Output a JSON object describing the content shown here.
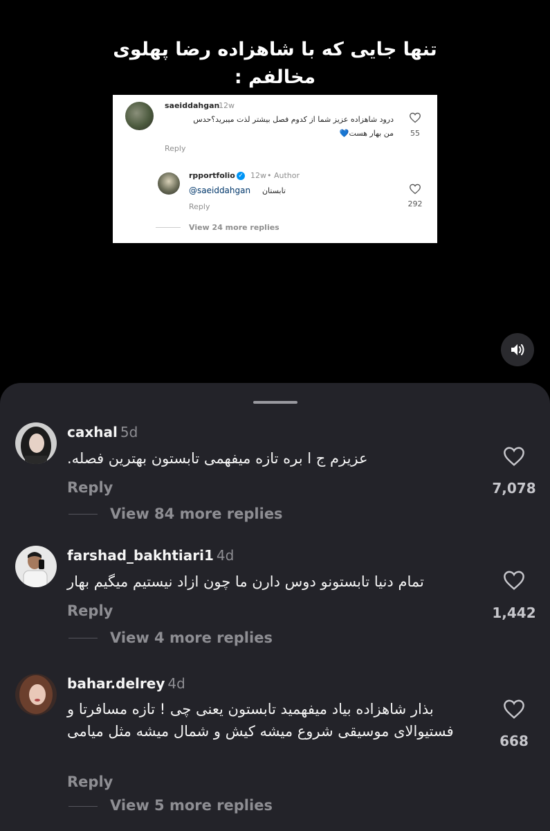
{
  "overlay": {
    "line1": "تنها جایی که با شاهزاده رضا پهلوی",
    "line2": "مخالفم :"
  },
  "embed": {
    "comment": {
      "username": "saeiddahgan",
      "time": "12w",
      "text_line1": "درود شاهزاده عزیز شما از کدوم فصل بیشتر لذت میبرید؟حدس",
      "text_line2": "من بهار هست💙",
      "reply_label": "Reply",
      "likes": "55"
    },
    "reply": {
      "username": "rpportfolio",
      "time": "12w",
      "author_label": "• Author",
      "mention": "@saeiddahgan",
      "text": "تابستان",
      "reply_label": "Reply",
      "likes": "292"
    },
    "view_more": "View 24 more replies"
  },
  "comments": [
    {
      "username": "caxhal",
      "time": "5d",
      "text": "عزیزم ج ا بره تازه میفهمی تابستون بهترین فصله.",
      "reply_label": "Reply",
      "likes": "7,078",
      "view_more": "View 84 more replies"
    },
    {
      "username": "farshad_bakhtiari1",
      "time": "4d",
      "text": "تمام دنیا تابستونو دوس دارن ما چون ازاد نیستیم میگیم بهار",
      "reply_label": "Reply",
      "likes": "1,442",
      "view_more": "View 4 more replies"
    },
    {
      "username": "bahar.delrey",
      "time": "4d",
      "text": "بذار شاهزاده بیاد میفهمید تابستون یعنی چی ! تازه مسافرتا و فستیوالای موسیقی شروع میشه کیش و شمال میشه مثل میامی",
      "reply_label": "Reply",
      "likes": "668",
      "view_more": "View 5 more replies"
    }
  ],
  "icons": {
    "sound": "speaker-icon",
    "like": "heart-icon",
    "verified": "verified-badge-icon"
  },
  "colors": {
    "sheet_bg": "#232329",
    "muted_text": "#8e8e93",
    "verified_blue": "#0095f6"
  }
}
